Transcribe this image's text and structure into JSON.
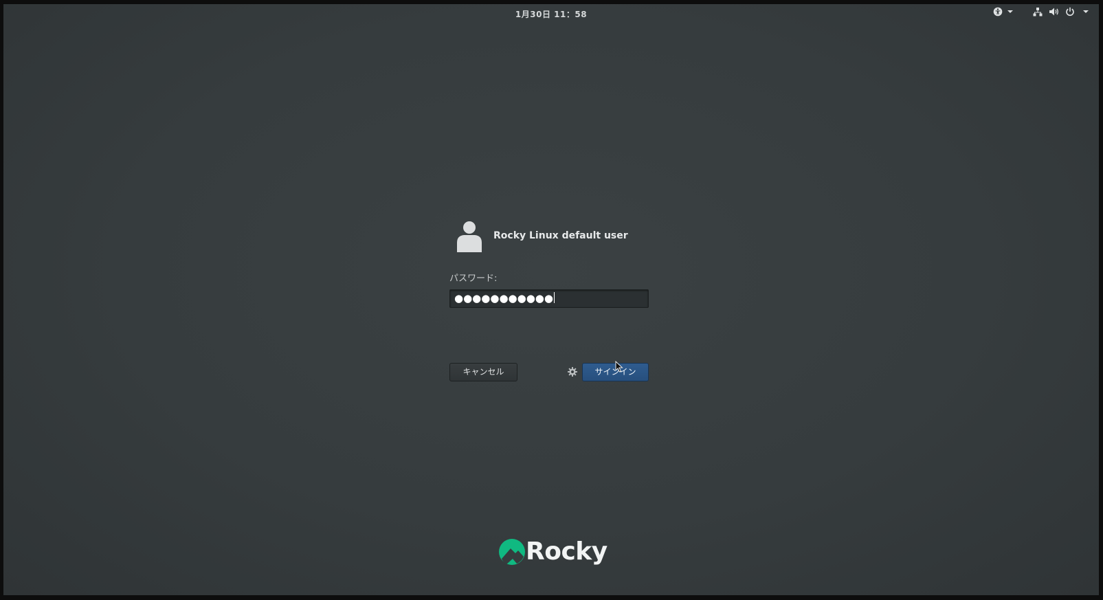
{
  "topbar": {
    "clock": "1月30日 11：58"
  },
  "login": {
    "user_name": "Rocky Linux default user",
    "password_label": "パスワード:",
    "password_value": "●●●●●●●●●●●",
    "cancel_label": "キャンセル",
    "signin_label": "サインイン"
  },
  "logo": {
    "text": "Rocky",
    "color": "#10b981"
  },
  "icons": {
    "accessibility": "accessibility-icon",
    "network": "network-icon",
    "volume": "volume-icon",
    "power": "power-icon",
    "settings": "gear-icon",
    "avatar": "user-avatar-icon"
  }
}
